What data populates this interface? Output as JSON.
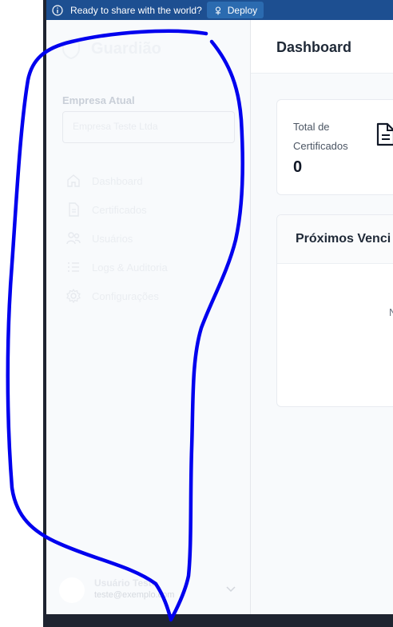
{
  "banner": {
    "message": "Ready to share with the world?",
    "deploy_label": "Deploy",
    "background": "#1d4f91"
  },
  "sidebar": {
    "brand": "Guardião",
    "company_label": "Empresa Atual",
    "company_value": "Empresa Teste Ltda",
    "items": [
      {
        "label": "Dashboard",
        "icon": "home-icon"
      },
      {
        "label": "Certificados",
        "icon": "document-icon"
      },
      {
        "label": "Usuários",
        "icon": "users-icon"
      },
      {
        "label": "Logs & Auditoria",
        "icon": "list-icon"
      },
      {
        "label": "Configurações",
        "icon": "gear-icon"
      }
    ],
    "user": {
      "name": "Usuário Teste",
      "email": "teste@exemplo.com"
    }
  },
  "header": {
    "title": "Dashboard"
  },
  "stats": {
    "label": "Total de Certificados",
    "value": "0"
  },
  "upcoming": {
    "title": "Próximos Venci",
    "empty_text": "N"
  },
  "colors": {
    "annotation_stroke": "#0000ee",
    "sidebar_bg": "#f8fafc",
    "main_bg": "#f8fafc"
  }
}
